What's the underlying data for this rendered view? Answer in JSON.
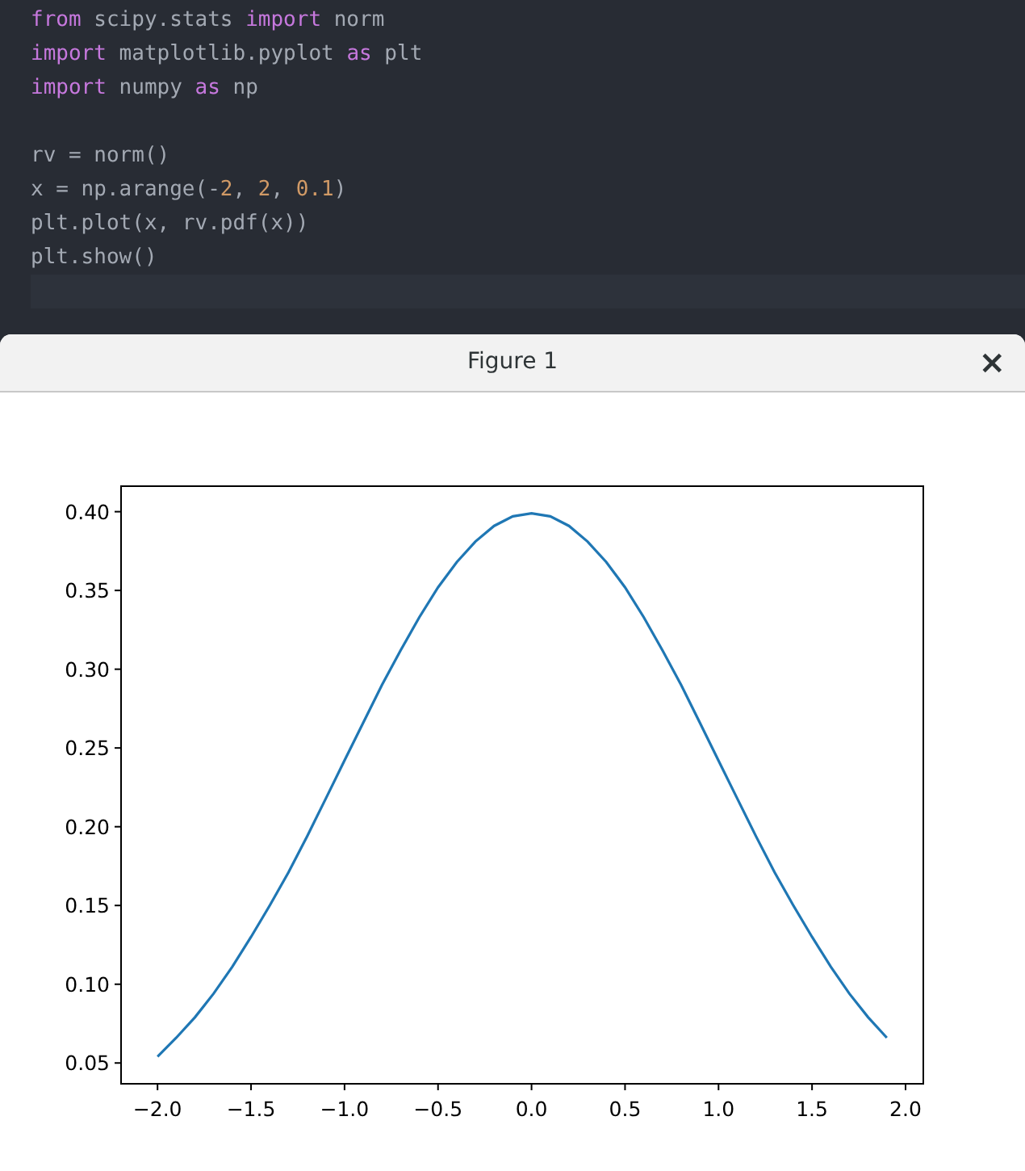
{
  "editor": {
    "lines": [
      {
        "kind": "code",
        "segments": [
          {
            "kind": "keyword",
            "text": "from"
          },
          {
            "kind": "plain",
            "text": " scipy.stats "
          },
          {
            "kind": "keyword",
            "text": "import"
          },
          {
            "kind": "plain",
            "text": " norm"
          }
        ]
      },
      {
        "kind": "code",
        "segments": [
          {
            "kind": "keyword",
            "text": "import"
          },
          {
            "kind": "plain",
            "text": " matplotlib.pyplot "
          },
          {
            "kind": "keyword",
            "text": "as"
          },
          {
            "kind": "plain",
            "text": " plt"
          }
        ]
      },
      {
        "kind": "code",
        "segments": [
          {
            "kind": "keyword",
            "text": "import"
          },
          {
            "kind": "plain",
            "text": " numpy "
          },
          {
            "kind": "keyword",
            "text": "as"
          },
          {
            "kind": "plain",
            "text": " np"
          }
        ]
      },
      {
        "kind": "blank"
      },
      {
        "kind": "code",
        "segments": [
          {
            "kind": "plain",
            "text": "rv = norm()"
          }
        ]
      },
      {
        "kind": "code",
        "segments": [
          {
            "kind": "plain",
            "text": "x = np.arange(-"
          },
          {
            "kind": "number",
            "text": "2"
          },
          {
            "kind": "plain",
            "text": ", "
          },
          {
            "kind": "number",
            "text": "2"
          },
          {
            "kind": "plain",
            "text": ", "
          },
          {
            "kind": "number",
            "text": "0.1"
          },
          {
            "kind": "plain",
            "text": ")"
          }
        ]
      },
      {
        "kind": "code",
        "segments": [
          {
            "kind": "plain",
            "text": "plt.plot(x, rv.pdf(x))"
          }
        ]
      },
      {
        "kind": "code",
        "segments": [
          {
            "kind": "plain",
            "text": "plt.show()"
          }
        ]
      },
      {
        "kind": "current"
      }
    ]
  },
  "figure_window": {
    "title": "Figure 1",
    "close": "×",
    "chart_data": {
      "type": "line",
      "x": [
        -2.0,
        -1.9,
        -1.8,
        -1.7,
        -1.6,
        -1.5,
        -1.4,
        -1.3,
        -1.2,
        -1.1,
        -1.0,
        -0.9,
        -0.8,
        -0.7,
        -0.6,
        -0.5,
        -0.4,
        -0.3,
        -0.2,
        -0.1,
        0.0,
        0.1,
        0.2,
        0.3,
        0.4,
        0.5,
        0.6,
        0.7,
        0.8,
        0.9,
        1.0,
        1.1,
        1.2,
        1.3,
        1.4,
        1.5,
        1.6,
        1.7,
        1.8,
        1.9
      ],
      "series": [
        {
          "color": "#1f77b4",
          "values": [
            0.054,
            0.066,
            0.079,
            0.094,
            0.111,
            0.13,
            0.15,
            0.171,
            0.194,
            0.218,
            0.242,
            0.266,
            0.29,
            0.312,
            0.333,
            0.352,
            0.368,
            0.381,
            0.391,
            0.397,
            0.399,
            0.397,
            0.391,
            0.381,
            0.368,
            0.352,
            0.333,
            0.312,
            0.29,
            0.266,
            0.242,
            0.218,
            0.194,
            0.171,
            0.15,
            0.13,
            0.111,
            0.094,
            0.079,
            0.066
          ]
        }
      ],
      "xlim": [
        -2.195,
        2.095
      ],
      "ylim": [
        0.0368,
        0.4162
      ],
      "xticks": [
        {
          "value": -2.0,
          "label": "−2.0"
        },
        {
          "value": -1.5,
          "label": "−1.5"
        },
        {
          "value": -1.0,
          "label": "−1.0"
        },
        {
          "value": -0.5,
          "label": "−0.5"
        },
        {
          "value": 0.0,
          "label": "0.0"
        },
        {
          "value": 0.5,
          "label": "0.5"
        },
        {
          "value": 1.0,
          "label": "1.0"
        },
        {
          "value": 1.5,
          "label": "1.5"
        },
        {
          "value": 2.0,
          "label": "2.0"
        }
      ],
      "yticks": [
        {
          "value": 0.05,
          "label": "0.05"
        },
        {
          "value": 0.1,
          "label": "0.10"
        },
        {
          "value": 0.15,
          "label": "0.15"
        },
        {
          "value": 0.2,
          "label": "0.20"
        },
        {
          "value": 0.25,
          "label": "0.25"
        },
        {
          "value": 0.3,
          "label": "0.30"
        },
        {
          "value": 0.35,
          "label": "0.35"
        },
        {
          "value": 0.4,
          "label": "0.40"
        }
      ]
    }
  }
}
